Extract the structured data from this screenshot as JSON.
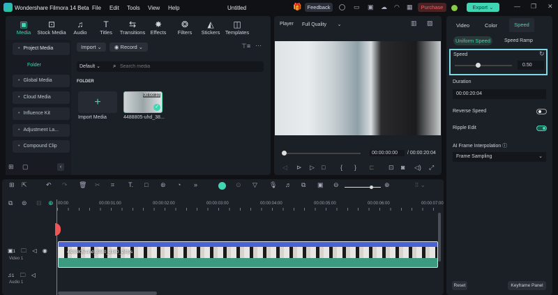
{
  "app": {
    "title": "Wondershare Filmora 14 Beta",
    "project": "Untitled",
    "menu": [
      "File",
      "Edit",
      "Tools",
      "View",
      "Help"
    ],
    "feedback": "Feedback",
    "purchase": "Purchase",
    "export": "Export"
  },
  "toolbar": [
    {
      "label": "Media",
      "icon": "media-icon"
    },
    {
      "label": "Stock Media",
      "icon": "stock-media-icon"
    },
    {
      "label": "Audio",
      "icon": "music-note-icon"
    },
    {
      "label": "Titles",
      "icon": "text-icon"
    },
    {
      "label": "Transitions",
      "icon": "transitions-icon"
    },
    {
      "label": "Effects",
      "icon": "effects-icon"
    },
    {
      "label": "Filters",
      "icon": "filters-icon"
    },
    {
      "label": "Stickers",
      "icon": "stickers-icon"
    },
    {
      "label": "Templates",
      "icon": "templates-icon"
    }
  ],
  "media": {
    "sidebar": [
      "Project Media",
      "Folder",
      "Global Media",
      "Cloud Media",
      "Influence Kit",
      "Adjustment La...",
      "Compound Clip"
    ],
    "import": "Import",
    "record": "Record",
    "sort": "Default",
    "search_placeholder": "Search media",
    "folder_heading": "FOLDER",
    "import_media": "Import Media",
    "clip_name": "4488805-uhd_38...",
    "clip_duration": "00:00:10"
  },
  "player": {
    "label": "Player",
    "quality": "Full Quality",
    "current_time": "00:00:00:00",
    "total_time": "/ 00:00:20:04",
    "progress": 0
  },
  "inspector": {
    "tabs": [
      "Video",
      "Color",
      "Speed"
    ],
    "active_tab": "Speed",
    "subtabs": [
      "Uniform Speed",
      "Speed Ramp"
    ],
    "speed_label": "Speed",
    "speed_value": "0.50",
    "duration_label": "Duration",
    "duration_value": "00:00:20:04",
    "reverse_label": "Reverse Speed",
    "reverse_on": false,
    "ripple_label": "Ripple Edit",
    "ripple_on": true,
    "ai_label": "AI Frame Interpolation",
    "ai_value": "Frame Sampling",
    "reset": "Reset",
    "keyframe": "Keyframe Panel"
  },
  "timeline": {
    "ruler": [
      "00:00",
      "00:00:01:00",
      "00:00:02:00",
      "00:00:03:00",
      "00:00:04:00",
      "00:00:05:00",
      "00:00:06:00",
      "00:00:07:00"
    ],
    "video_track": "Video 1",
    "audio_track": "Audio 1",
    "clip_label": "4488805-uhd_3840_2160_24fps",
    "track_num": "1"
  },
  "colors": {
    "accent": "#3fd6b4",
    "purchase": "#e7665f",
    "highlight": "#7fd8e6"
  }
}
